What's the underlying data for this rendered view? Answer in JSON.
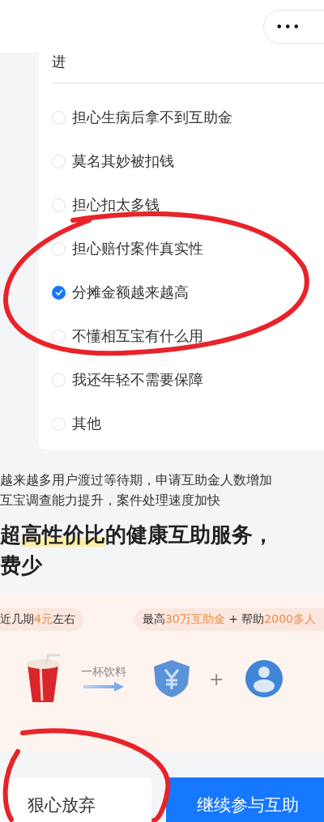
{
  "header": {
    "menu_button": "•••"
  },
  "question_tail": "进",
  "options": [
    {
      "label": "担心生病后拿不到互助金",
      "selected": false
    },
    {
      "label": "莫名其妙被扣钱",
      "selected": false
    },
    {
      "label": "担心扣太多钱",
      "selected": false
    },
    {
      "label": "担心赔付案件真实性",
      "selected": false
    },
    {
      "label": "分摊金额越来越高",
      "selected": true
    },
    {
      "label": "不懂相互宝有什么用",
      "selected": false
    },
    {
      "label": "我还年轻不需要保障",
      "selected": false
    },
    {
      "label": "其他",
      "selected": false
    }
  ],
  "notes": [
    "越来越多用户渡过等待期，申请互助金人数增加",
    "互宝调查能力提升，案件处理速度加快"
  ],
  "headline": [
    [
      {
        "text": "超",
        "highlight": false
      },
      {
        "text": "高性价比",
        "highlight": true
      },
      {
        "text": "的健康互助服务，",
        "highlight": false
      }
    ],
    [
      {
        "text": "费少",
        "highlight": false
      }
    ]
  ],
  "banner": {
    "pills": [
      [
        {
          "text": "近几期",
          "accent": false
        },
        {
          "text": "4元",
          "accent": true
        },
        {
          "text": "左右",
          "accent": false
        }
      ],
      [
        {
          "text": "最高",
          "accent": false
        },
        {
          "text": "30万互助金",
          "accent": true
        },
        {
          "text": " + 帮助",
          "accent": false
        },
        {
          "text": "2000多人",
          "accent": true
        }
      ]
    ],
    "arrow_label": "一杯饮料",
    "plus": "+"
  },
  "buttons": [
    {
      "label": "狠心放弃",
      "kind": "secondary"
    },
    {
      "label": "继续参与互助",
      "kind": "primary"
    }
  ]
}
